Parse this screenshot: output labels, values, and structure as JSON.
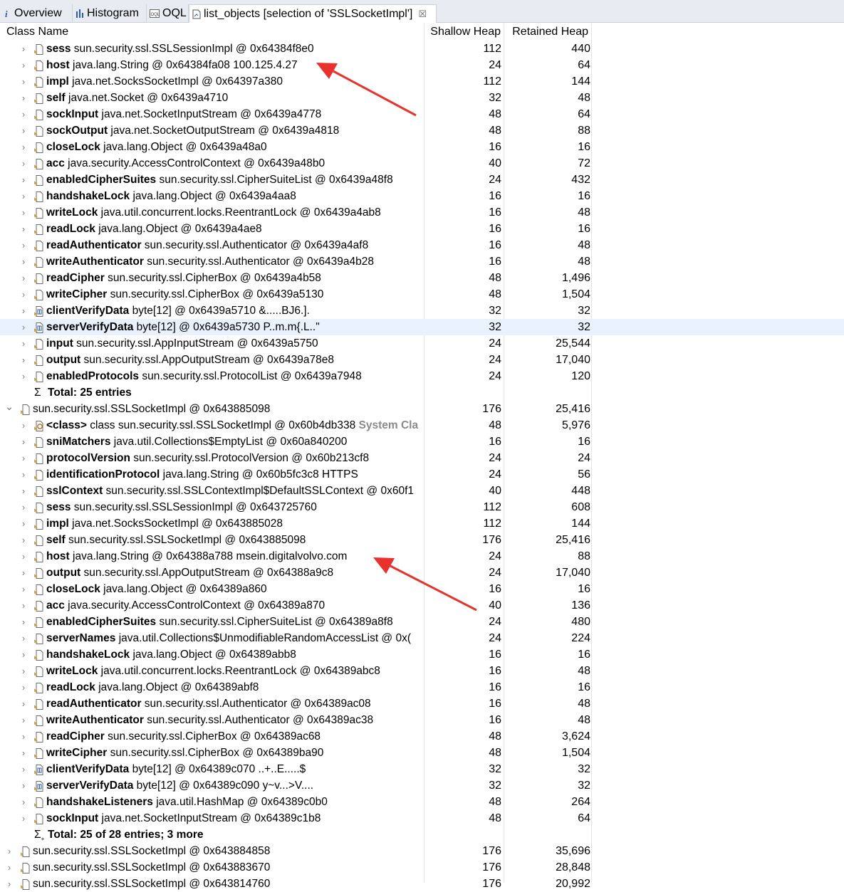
{
  "tabs": [
    {
      "label": "Overview",
      "icon": "info-icon"
    },
    {
      "label": "Histogram",
      "icon": "histogram-icon"
    },
    {
      "label": "OQL",
      "icon": "oql-icon"
    },
    {
      "label": "list_objects [selection of 'SSLSocketImpl']",
      "icon": "list-objects-icon",
      "close": "☒"
    }
  ],
  "columns": {
    "name": "Class Name",
    "shallow": "Shallow Heap",
    "retained": "Retained Heap"
  },
  "rows": [
    {
      "kind": "field",
      "field": "sess",
      "desc": " sun.security.ssl.SSLSessionImpl @ 0x64384f8e0",
      "shallow": "112",
      "retained": "440"
    },
    {
      "kind": "field",
      "field": "host",
      "desc": " java.lang.String @ 0x64384fa08  100.125.4.27",
      "shallow": "24",
      "retained": "64"
    },
    {
      "kind": "field",
      "field": "impl",
      "desc": " java.net.SocksSocketImpl @ 0x64397a380",
      "shallow": "112",
      "retained": "144"
    },
    {
      "kind": "field",
      "field": "self",
      "desc": " java.net.Socket @ 0x6439a4710",
      "shallow": "32",
      "retained": "48"
    },
    {
      "kind": "field",
      "field": "sockInput",
      "desc": " java.net.SocketInputStream @ 0x6439a4778",
      "shallow": "48",
      "retained": "64"
    },
    {
      "kind": "field",
      "field": "sockOutput",
      "desc": " java.net.SocketOutputStream @ 0x6439a4818",
      "shallow": "48",
      "retained": "88"
    },
    {
      "kind": "field",
      "field": "closeLock",
      "desc": " java.lang.Object @ 0x6439a48a0",
      "shallow": "16",
      "retained": "16"
    },
    {
      "kind": "field",
      "field": "acc",
      "desc": " java.security.AccessControlContext @ 0x6439a48b0",
      "shallow": "40",
      "retained": "72"
    },
    {
      "kind": "field",
      "field": "enabledCipherSuites",
      "desc": " sun.security.ssl.CipherSuiteList @ 0x6439a48f8",
      "shallow": "24",
      "retained": "432"
    },
    {
      "kind": "field",
      "field": "handshakeLock",
      "desc": " java.lang.Object @ 0x6439a4aa8",
      "shallow": "16",
      "retained": "16"
    },
    {
      "kind": "field",
      "field": "writeLock",
      "desc": " java.util.concurrent.locks.ReentrantLock @ 0x6439a4ab8",
      "shallow": "16",
      "retained": "48"
    },
    {
      "kind": "field",
      "field": "readLock",
      "desc": " java.lang.Object @ 0x6439a4ae8",
      "shallow": "16",
      "retained": "16"
    },
    {
      "kind": "field",
      "field": "readAuthenticator",
      "desc": " sun.security.ssl.Authenticator @ 0x6439a4af8",
      "shallow": "16",
      "retained": "48"
    },
    {
      "kind": "field",
      "field": "writeAuthenticator",
      "desc": " sun.security.ssl.Authenticator @ 0x6439a4b28",
      "shallow": "16",
      "retained": "48"
    },
    {
      "kind": "field",
      "field": "readCipher",
      "desc": " sun.security.ssl.CipherBox @ 0x6439a4b58",
      "shallow": "48",
      "retained": "1,496"
    },
    {
      "kind": "field",
      "field": "writeCipher",
      "desc": " sun.security.ssl.CipherBox @ 0x6439a5130",
      "shallow": "48",
      "retained": "1,504"
    },
    {
      "kind": "array",
      "field": "clientVerifyData",
      "desc": " byte[12] @ 0x6439a5710  &.....BJ6.].",
      "shallow": "32",
      "retained": "32"
    },
    {
      "kind": "array",
      "field": "serverVerifyData",
      "desc": " byte[12] @ 0x6439a5730  P..m.m{.L..\"",
      "shallow": "32",
      "retained": "32",
      "selected": true
    },
    {
      "kind": "field",
      "field": "input",
      "desc": " sun.security.ssl.AppInputStream @ 0x6439a5750",
      "shallow": "24",
      "retained": "25,544"
    },
    {
      "kind": "field",
      "field": "output",
      "desc": " sun.security.ssl.AppOutputStream @ 0x6439a78e8",
      "shallow": "24",
      "retained": "17,040"
    },
    {
      "kind": "field",
      "field": "enabledProtocols",
      "desc": " sun.security.ssl.ProtocolList @ 0x6439a7948",
      "shallow": "24",
      "retained": "120"
    },
    {
      "kind": "total",
      "field": "Total: 25 entries",
      "desc": "",
      "shallow": "",
      "retained": ""
    },
    {
      "kind": "object",
      "field": "",
      "desc": "sun.security.ssl.SSLSocketImpl @ 0x643885098",
      "shallow": "176",
      "retained": "25,416",
      "expanded": true
    },
    {
      "kind": "class",
      "field": "<class>",
      "desc": " class sun.security.ssl.SSLSocketImpl @ 0x60b4db338 ",
      "extra": "System Cla",
      "shallow": "48",
      "retained": "5,976"
    },
    {
      "kind": "field",
      "field": "sniMatchers",
      "desc": " java.util.Collections$EmptyList @ 0x60a840200",
      "shallow": "16",
      "retained": "16"
    },
    {
      "kind": "field",
      "field": "protocolVersion",
      "desc": " sun.security.ssl.ProtocolVersion @ 0x60b213cf8",
      "shallow": "24",
      "retained": "24"
    },
    {
      "kind": "field",
      "field": "identificationProtocol",
      "desc": " java.lang.String @ 0x60b5fc3c8  HTTPS",
      "shallow": "24",
      "retained": "56"
    },
    {
      "kind": "field",
      "field": "sslContext",
      "desc": " sun.security.ssl.SSLContextImpl$DefaultSSLContext @ 0x60f1",
      "shallow": "40",
      "retained": "448"
    },
    {
      "kind": "field",
      "field": "sess",
      "desc": " sun.security.ssl.SSLSessionImpl @ 0x643725760",
      "shallow": "112",
      "retained": "608"
    },
    {
      "kind": "field",
      "field": "impl",
      "desc": " java.net.SocksSocketImpl @ 0x643885028",
      "shallow": "112",
      "retained": "144"
    },
    {
      "kind": "field",
      "field": "self",
      "desc": " sun.security.ssl.SSLSocketImpl @ 0x643885098",
      "shallow": "176",
      "retained": "25,416"
    },
    {
      "kind": "field",
      "field": "host",
      "desc": " java.lang.String @ 0x64388a788  msein.digitalvolvo.com",
      "shallow": "24",
      "retained": "88"
    },
    {
      "kind": "field",
      "field": "output",
      "desc": " sun.security.ssl.AppOutputStream @ 0x64388a9c8",
      "shallow": "24",
      "retained": "17,040"
    },
    {
      "kind": "field",
      "field": "closeLock",
      "desc": " java.lang.Object @ 0x64389a860",
      "shallow": "16",
      "retained": "16"
    },
    {
      "kind": "field",
      "field": "acc",
      "desc": " java.security.AccessControlContext @ 0x64389a870",
      "shallow": "40",
      "retained": "136"
    },
    {
      "kind": "field",
      "field": "enabledCipherSuites",
      "desc": " sun.security.ssl.CipherSuiteList @ 0x64389a8f8",
      "shallow": "24",
      "retained": "480"
    },
    {
      "kind": "field",
      "field": "serverNames",
      "desc": " java.util.Collections$UnmodifiableRandomAccessList @ 0x(",
      "shallow": "24",
      "retained": "224"
    },
    {
      "kind": "field",
      "field": "handshakeLock",
      "desc": " java.lang.Object @ 0x64389abb8",
      "shallow": "16",
      "retained": "16"
    },
    {
      "kind": "field",
      "field": "writeLock",
      "desc": " java.util.concurrent.locks.ReentrantLock @ 0x64389abc8",
      "shallow": "16",
      "retained": "48"
    },
    {
      "kind": "field",
      "field": "readLock",
      "desc": " java.lang.Object @ 0x64389abf8",
      "shallow": "16",
      "retained": "16"
    },
    {
      "kind": "field",
      "field": "readAuthenticator",
      "desc": " sun.security.ssl.Authenticator @ 0x64389ac08",
      "shallow": "16",
      "retained": "48"
    },
    {
      "kind": "field",
      "field": "writeAuthenticator",
      "desc": " sun.security.ssl.Authenticator @ 0x64389ac38",
      "shallow": "16",
      "retained": "48"
    },
    {
      "kind": "field",
      "field": "readCipher",
      "desc": " sun.security.ssl.CipherBox @ 0x64389ac68",
      "shallow": "48",
      "retained": "3,624"
    },
    {
      "kind": "field",
      "field": "writeCipher",
      "desc": " sun.security.ssl.CipherBox @ 0x64389ba90",
      "shallow": "48",
      "retained": "1,504"
    },
    {
      "kind": "array",
      "field": "clientVerifyData",
      "desc": " byte[12] @ 0x64389c070  ..+..E.....$",
      "shallow": "32",
      "retained": "32"
    },
    {
      "kind": "array",
      "field": "serverVerifyData",
      "desc": " byte[12] @ 0x64389c090  y~v...>V....",
      "shallow": "32",
      "retained": "32"
    },
    {
      "kind": "field",
      "field": "handshakeListeners",
      "desc": " java.util.HashMap @ 0x64389c0b0",
      "shallow": "48",
      "retained": "264"
    },
    {
      "kind": "field",
      "field": "sockInput",
      "desc": " java.net.SocketInputStream @ 0x64389c1b8",
      "shallow": "48",
      "retained": "64"
    },
    {
      "kind": "total",
      "field": "Total: 25 of 28 entries; 3 more",
      "desc": "",
      "shallow": "",
      "retained": "",
      "more": true
    },
    {
      "kind": "object",
      "field": "",
      "desc": "sun.security.ssl.SSLSocketImpl @ 0x643884858",
      "shallow": "176",
      "retained": "35,696"
    },
    {
      "kind": "object",
      "field": "",
      "desc": "sun.security.ssl.SSLSocketImpl @ 0x643883670",
      "shallow": "176",
      "retained": "28,848"
    },
    {
      "kind": "object",
      "field": "",
      "desc": "sun.security.ssl.SSLSocketImpl @ 0x643814760",
      "shallow": "176",
      "retained": "20,992"
    }
  ],
  "annotations": {
    "arrow_color": "#e8322d"
  }
}
